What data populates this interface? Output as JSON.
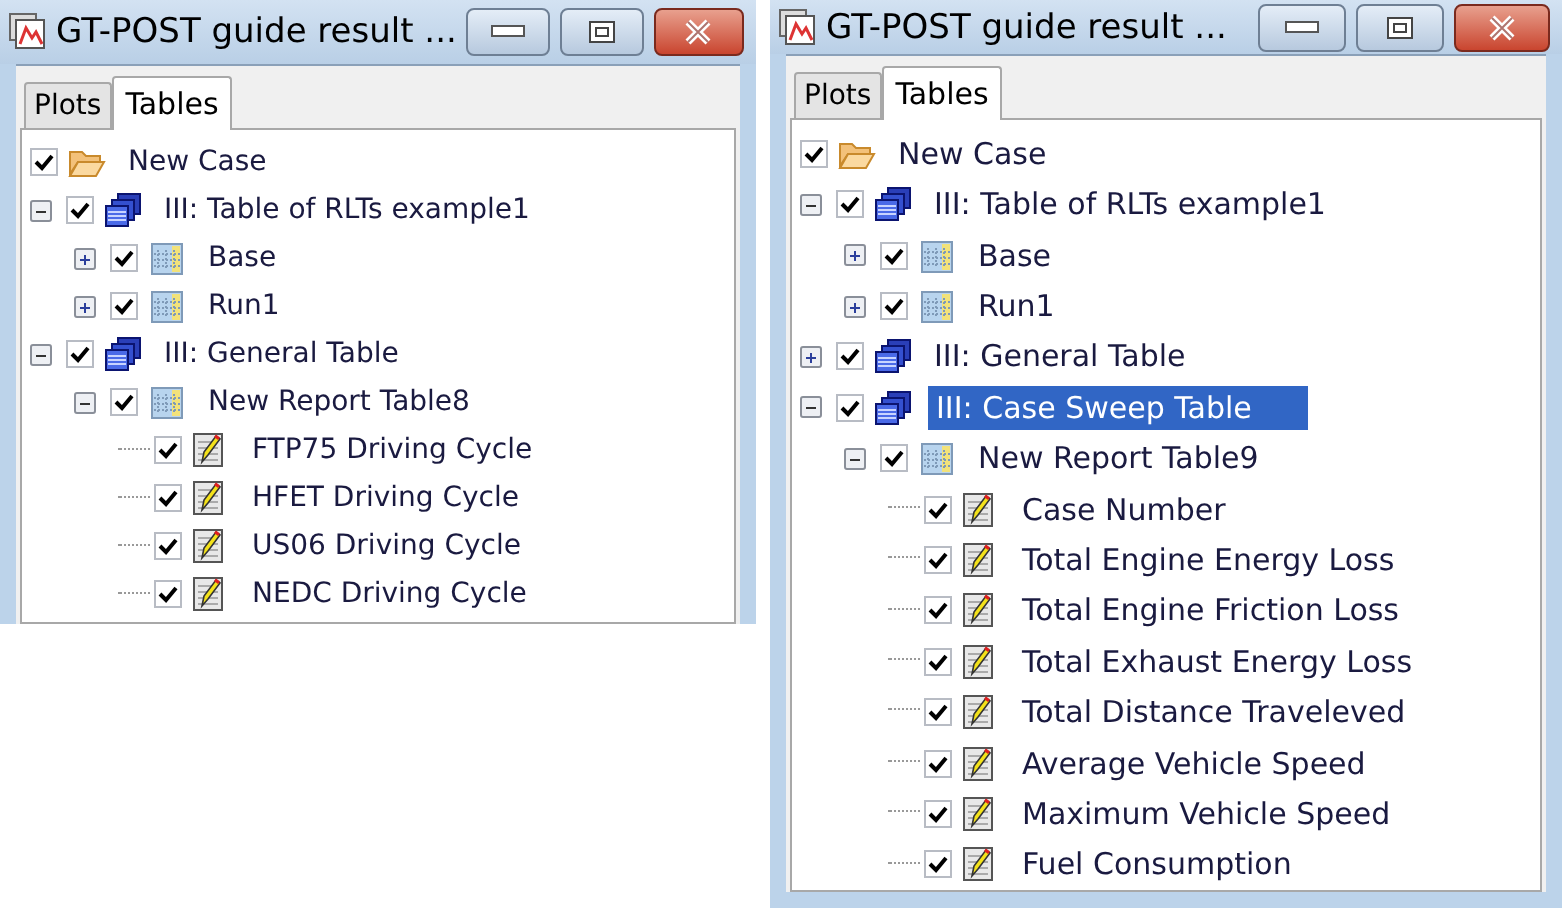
{
  "windows": [
    {
      "title": "GT-POST guide result ...",
      "tabs": [
        {
          "label": "Plots",
          "selected": false
        },
        {
          "label": "Tables",
          "selected": true
        }
      ],
      "tree": [
        {
          "label": "New Case",
          "kind": "folder",
          "checked": true,
          "selected": false,
          "children": [
            {
              "label": "III: Table of RLTs example1",
              "kind": "stack",
              "checked": true,
              "expanded": true,
              "selected": false,
              "children": [
                {
                  "label": "Base",
                  "kind": "table",
                  "checked": true,
                  "expanded": false,
                  "selected": false
                },
                {
                  "label": "Run1",
                  "kind": "table",
                  "checked": true,
                  "expanded": false,
                  "selected": false
                }
              ]
            },
            {
              "label": "III: General Table",
              "kind": "stack",
              "checked": true,
              "expanded": true,
              "selected": false,
              "children": [
                {
                  "label": "New Report Table8",
                  "kind": "table",
                  "checked": true,
                  "expanded": true,
                  "selected": false,
                  "children": [
                    {
                      "label": "FTP75 Driving Cycle",
                      "kind": "item",
                      "checked": true,
                      "selected": false
                    },
                    {
                      "label": "HFET Driving Cycle",
                      "kind": "item",
                      "checked": true,
                      "selected": false
                    },
                    {
                      "label": "US06 Driving Cycle",
                      "kind": "item",
                      "checked": true,
                      "selected": false
                    },
                    {
                      "label": "NEDC Driving Cycle",
                      "kind": "item",
                      "checked": true,
                      "selected": false
                    }
                  ]
                }
              ]
            }
          ]
        }
      ]
    },
    {
      "title": "GT-POST guide result ...",
      "tabs": [
        {
          "label": "Plots",
          "selected": false
        },
        {
          "label": "Tables",
          "selected": true
        }
      ],
      "tree": [
        {
          "label": "New Case",
          "kind": "folder",
          "checked": true,
          "selected": false,
          "children": [
            {
              "label": "III: Table of RLTs example1",
              "kind": "stack",
              "checked": true,
              "expanded": true,
              "selected": false,
              "children": [
                {
                  "label": "Base",
                  "kind": "table",
                  "checked": true,
                  "expanded": false,
                  "selected": false
                },
                {
                  "label": "Run1",
                  "kind": "table",
                  "checked": true,
                  "expanded": false,
                  "selected": false
                }
              ]
            },
            {
              "label": "III: General Table",
              "kind": "stack",
              "checked": true,
              "expanded": false,
              "selected": false
            },
            {
              "label": "III: Case Sweep Table",
              "kind": "stack",
              "checked": true,
              "expanded": true,
              "selected": true,
              "children": [
                {
                  "label": "New Report Table9",
                  "kind": "table",
                  "checked": true,
                  "expanded": true,
                  "selected": false,
                  "children": [
                    {
                      "label": "Case Number",
                      "kind": "item",
                      "checked": true,
                      "selected": false
                    },
                    {
                      "label": "Total Engine Energy Loss",
                      "kind": "item",
                      "checked": true,
                      "selected": false
                    },
                    {
                      "label": "Total Engine Friction Loss",
                      "kind": "item",
                      "checked": true,
                      "selected": false
                    },
                    {
                      "label": "Total Exhaust Energy Loss",
                      "kind": "item",
                      "checked": true,
                      "selected": false
                    },
                    {
                      "label": "Total Distance Traveleved",
                      "kind": "item",
                      "checked": true,
                      "selected": false
                    },
                    {
                      "label": "Average Vehicle Speed",
                      "kind": "item",
                      "checked": true,
                      "selected": false
                    },
                    {
                      "label": "Maximum Vehicle Speed",
                      "kind": "item",
                      "checked": true,
                      "selected": false
                    },
                    {
                      "label": "Fuel Consumption",
                      "kind": "item",
                      "checked": true,
                      "selected": false
                    }
                  ]
                }
              ]
            }
          ]
        }
      ]
    }
  ]
}
